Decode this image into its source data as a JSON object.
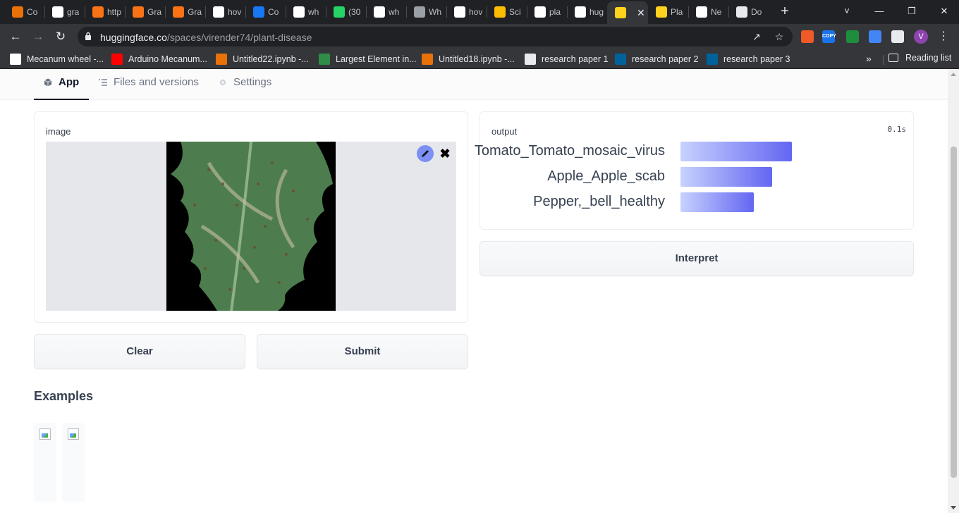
{
  "browser": {
    "tabs": [
      {
        "icon": "colab-icon",
        "label": "Co",
        "color": "#e8710a"
      },
      {
        "icon": "google-icon",
        "label": "gra",
        "color": "#ffffff"
      },
      {
        "icon": "gradio-icon",
        "label": "http",
        "color": "#f97316"
      },
      {
        "icon": "gradio-icon",
        "label": "Gra",
        "color": "#f97316"
      },
      {
        "icon": "gradio-icon",
        "label": "Gra",
        "color": "#f97316"
      },
      {
        "icon": "google-icon",
        "label": "hov",
        "color": "#ffffff"
      },
      {
        "icon": "meta-icon",
        "label": "Co",
        "color": "#1877f2"
      },
      {
        "icon": "google-icon",
        "label": "wh",
        "color": "#ffffff"
      },
      {
        "icon": "whatsapp-icon",
        "label": "(30",
        "color": "#25d366"
      },
      {
        "icon": "google-icon",
        "label": "wh",
        "color": "#ffffff"
      },
      {
        "icon": "github-icon",
        "label": "Wh",
        "color": "#9aa0a6"
      },
      {
        "icon": "google-icon",
        "label": "hov",
        "color": "#ffffff"
      },
      {
        "icon": "slides-icon",
        "label": "Sci",
        "color": "#fbbc04"
      },
      {
        "icon": "google-icon",
        "label": "pla",
        "color": "#ffffff"
      },
      {
        "icon": "google-icon",
        "label": "hug",
        "color": "#ffffff"
      },
      {
        "icon": "huggingface-icon",
        "label": "",
        "color": "#ffd21e"
      },
      {
        "icon": "huggingface-icon",
        "label": "Pla",
        "color": "#ffd21e"
      },
      {
        "icon": "chrome-icon",
        "label": "Ne",
        "color": "#ffffff"
      },
      {
        "icon": "download-icon",
        "label": "Do",
        "color": "#e8eaed"
      }
    ],
    "active_tab_index": 15,
    "url_host": "huggingface.co",
    "url_path": "/spaces/virender74/plant-disease",
    "profile_initial": "V",
    "extensions": [
      {
        "name": "brave-lion-extension-icon",
        "label": "",
        "color": "#f05a28"
      },
      {
        "name": "copy-extension-icon",
        "label": "COPY",
        "color": "#1a73e8"
      },
      {
        "name": "eyedropper-extension-icon",
        "label": "",
        "color": "#1e8e3e"
      },
      {
        "name": "window-extension-icon",
        "label": "",
        "color": "#4285f4"
      },
      {
        "name": "puzzle-extensions-icon",
        "label": "",
        "color": "#e8eaed"
      }
    ],
    "bookmarks": [
      {
        "icon": "wikipedia-icon",
        "label": "Mecanum wheel -...",
        "color": "#ffffff"
      },
      {
        "icon": "youtube-icon",
        "label": "Arduino Mecanum...",
        "color": "#ff0000"
      },
      {
        "icon": "colab-icon",
        "label": "Untitled22.ipynb -...",
        "color": "#e8710a"
      },
      {
        "icon": "geeksforgeeks-icon",
        "label": "Largest Element in...",
        "color": "#2f8d46"
      },
      {
        "icon": "colab-icon",
        "label": "Untitled18.ipynb -...",
        "color": "#e8710a"
      },
      {
        "icon": "globe-icon",
        "label": "research paper 1",
        "color": "#e8eaed"
      },
      {
        "icon": "ieee-icon",
        "label": "research paper 2",
        "color": "#00629b"
      },
      {
        "icon": "ieee-icon",
        "label": "research paper 3",
        "color": "#00629b"
      }
    ],
    "more_bookmarks": "»",
    "reading_list": "Reading list"
  },
  "space": {
    "tabs": [
      {
        "label": "App",
        "active": true
      },
      {
        "label": "Files and versions",
        "active": false
      },
      {
        "label": "Settings",
        "active": false
      }
    ]
  },
  "input_panel": {
    "label": "image",
    "edit_icon": "pencil-icon",
    "clear_icon": "close-icon"
  },
  "output_panel": {
    "label": "output",
    "timing": "0.1s",
    "confidences": [
      {
        "label": "Tomato_Tomato_mosaic_virus",
        "confidence": 0.5
      },
      {
        "label": "Apple_Apple_scab",
        "confidence": 0.41
      },
      {
        "label": "Pepper,_bell_healthy",
        "confidence": 0.33
      }
    ],
    "bar_colors": [
      "#c7d2fe",
      "#6366f1"
    ]
  },
  "buttons": {
    "clear": "Clear",
    "submit": "Submit",
    "interpret": "Interpret"
  },
  "examples": {
    "title": "Examples",
    "items": [
      {
        "icon": "broken-image-icon"
      },
      {
        "icon": "broken-image-icon"
      }
    ]
  }
}
